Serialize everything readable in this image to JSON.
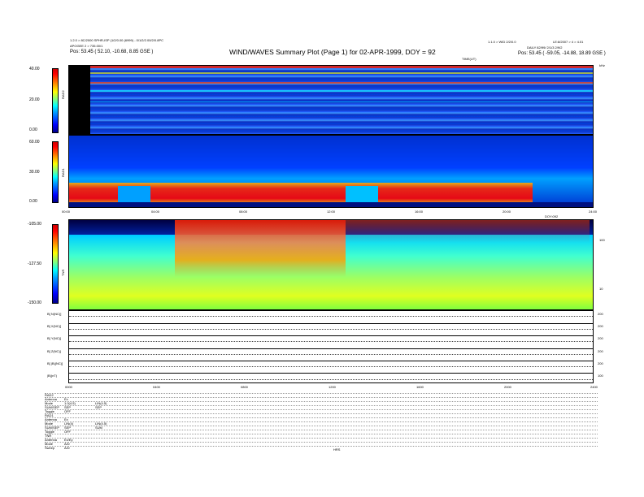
{
  "header": {
    "title": "WIND/WAVES Summary Plot (Page 1) for 02-APR-1999, DOY = 92",
    "left_line1": "1.2.0 > 8C/2000 SPHR-ISP (1/2/0.00 (6999) - 0/1/2/2.00/2/0.8PC",
    "left_line2": "APOGEE 2 > 735.00/1",
    "left_line3": "Pos:    53.45 ( 52.10,  -10.68,  8.85 GSE )",
    "right_line1": "1.1.0 > WID 2/2/0.0",
    "right_line2": "LE:8/2007 > 4 > 4.01",
    "right_line3": "DAILY  82/99/ 2/1/3 2/9/2",
    "right_line4": "Pos:    53.45 ( -59.05,  -14.88,  18.89 GSE )",
    "timemark_top": "TIME(UT)",
    "timemark_right": "kHz"
  },
  "panels": {
    "rad2": {
      "label": "RAD2",
      "ticks": [
        "40.00",
        "20.00",
        "0.00"
      ]
    },
    "rad1": {
      "label": "RAD1",
      "ticks": [
        "60.00",
        "30.00",
        "0.00"
      ]
    },
    "tnr": {
      "label": "TNR",
      "ticks": [
        "-105.00",
        "-127.50",
        "-150.00"
      ],
      "right_ticks": [
        "100",
        "10"
      ]
    },
    "time_axis": [
      "00:00",
      "04:00",
      "08:00",
      "12:00",
      "16:00",
      "20:00",
      "24:00"
    ],
    "time_axis_small": [
      "0000",
      "0400",
      "0800",
      "1200",
      "1600",
      "2000",
      "2400"
    ],
    "time_axis_label": "DOY:092",
    "line_plots": [
      {
        "label": "B[ N(NC)]",
        "right": "200"
      },
      {
        "label": "B[ X(NC)]",
        "right": "200"
      },
      {
        "label": "B[ Y(NC)]",
        "right": "200"
      },
      {
        "label": "B[ Z(NC)]",
        "right": "200"
      },
      {
        "label": "B[ |B|(NC)]",
        "right": "200"
      },
      {
        "label": "|B|(nT)",
        "right": "100"
      }
    ]
  },
  "footer": {
    "rows": [
      {
        "a": "RAD2",
        "b": "",
        "c": ""
      },
      {
        "a": "Antenna",
        "b": "Ex",
        "c": ""
      },
      {
        "a": "Mode",
        "b": "1.0(4.5)",
        "c": "LIN(4.5)"
      },
      {
        "a": "SUM/SEP",
        "b": "SEP",
        "c": "SEP"
      },
      {
        "a": "Toggle",
        "b": "OFF",
        "c": ""
      },
      {
        "a": "RAD1",
        "b": "",
        "c": ""
      },
      {
        "a": "Antenna",
        "b": "Ex",
        "c": ""
      },
      {
        "a": "Mode",
        "b": "LIN(4)",
        "c": "LIN(4.5)"
      },
      {
        "a": "SUM/SEP",
        "b": "SEP",
        "c": "SUM"
      },
      {
        "a": "Toggle",
        "b": "OFF",
        "c": ""
      },
      {
        "a": "TNR",
        "b": "",
        "c": ""
      },
      {
        "a": "Antenna",
        "b": "Ex/Ey",
        "c": ""
      },
      {
        "a": "Mode",
        "b": "A/D",
        "c": ""
      },
      {
        "a": "Sweep",
        "b": "A/D",
        "c": ""
      }
    ],
    "center_note": "HRS"
  },
  "chart_data": {
    "type": "heatmap",
    "title": "WIND/WAVES Summary Plot (Page 1) for 02-APR-1999, DOY = 92",
    "x_ticks": [
      "00:00",
      "04:00",
      "08:00",
      "12:00",
      "16:00",
      "20:00",
      "24:00"
    ],
    "panels": [
      {
        "name": "RAD2",
        "y_ticks": [
          40.0,
          20.0,
          0.0
        ]
      },
      {
        "name": "RAD1",
        "y_ticks": [
          60.0,
          30.0,
          0.0
        ]
      },
      {
        "name": "TNR",
        "y_ticks": [
          -105.0,
          -127.5,
          -150.0
        ]
      }
    ],
    "colors": {
      "low": "#00008a",
      "mid": "#00ffff",
      "high": "#ff0000"
    }
  }
}
